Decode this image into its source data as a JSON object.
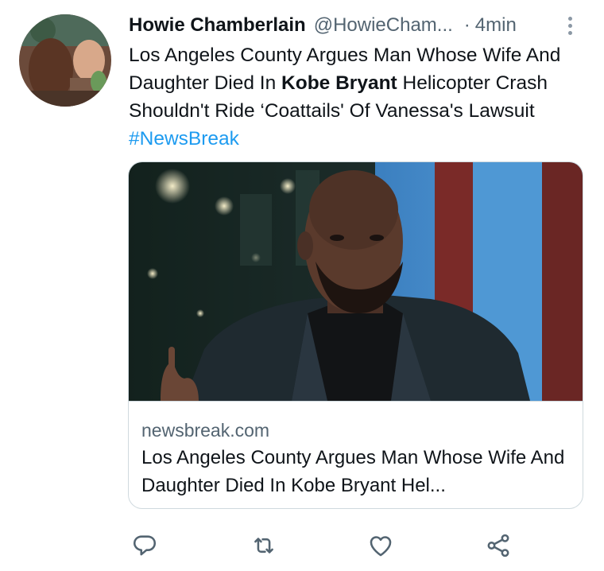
{
  "tweet": {
    "display_name": "Howie Chamberlain",
    "handle": "@HowieCham...",
    "separator": "·",
    "time": "4min",
    "text_part1": "Los Angeles County Argues Man Whose Wife And Daughter Died In ",
    "text_bold": "Kobe Bryant",
    "text_part2": " Helicopter Crash Shouldn't Ride ‘Coattails' Of Vanessa's Lawsuit ",
    "hashtag": "#NewsBreak"
  },
  "card": {
    "domain": "newsbreak.com",
    "title": "Los Angeles County Argues Man Whose Wife And Daughter Died In Kobe Bryant Hel..."
  },
  "icons": {
    "reply": "reply-icon",
    "retweet": "retweet-icon",
    "like": "like-icon",
    "share": "share-icon",
    "more": "more-icon"
  },
  "colors": {
    "link": "#1d9bf0",
    "secondary_text": "#536471",
    "primary_text": "#0f1419",
    "icon": "#536471"
  }
}
